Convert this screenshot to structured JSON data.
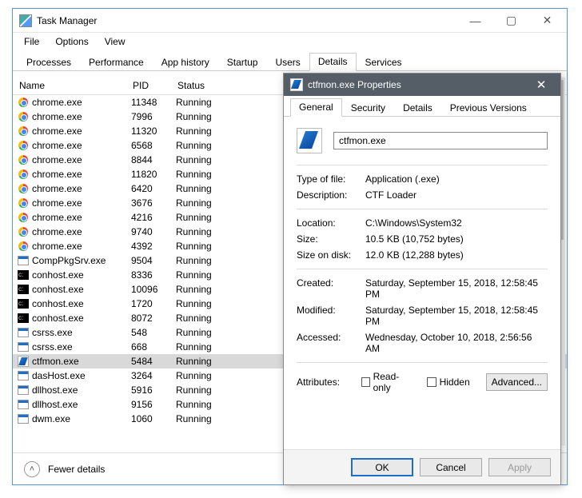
{
  "taskmgr": {
    "title": "Task Manager",
    "menu": {
      "file": "File",
      "options": "Options",
      "view": "View"
    },
    "tabs": {
      "processes": "Processes",
      "performance": "Performance",
      "app_history": "App history",
      "startup": "Startup",
      "users": "Users",
      "details": "Details",
      "services": "Services"
    },
    "columns": {
      "name": "Name",
      "pid": "PID",
      "status": "Status"
    },
    "fewer": "Fewer details",
    "rows": [
      {
        "icon": "chrome",
        "name": "chrome.exe",
        "pid": "11348",
        "status": "Running"
      },
      {
        "icon": "chrome",
        "name": "chrome.exe",
        "pid": "7996",
        "status": "Running"
      },
      {
        "icon": "chrome",
        "name": "chrome.exe",
        "pid": "11320",
        "status": "Running"
      },
      {
        "icon": "chrome",
        "name": "chrome.exe",
        "pid": "6568",
        "status": "Running"
      },
      {
        "icon": "chrome",
        "name": "chrome.exe",
        "pid": "8844",
        "status": "Running"
      },
      {
        "icon": "chrome",
        "name": "chrome.exe",
        "pid": "11820",
        "status": "Running"
      },
      {
        "icon": "chrome",
        "name": "chrome.exe",
        "pid": "6420",
        "status": "Running"
      },
      {
        "icon": "chrome",
        "name": "chrome.exe",
        "pid": "3676",
        "status": "Running"
      },
      {
        "icon": "chrome",
        "name": "chrome.exe",
        "pid": "4216",
        "status": "Running"
      },
      {
        "icon": "chrome",
        "name": "chrome.exe",
        "pid": "9740",
        "status": "Running"
      },
      {
        "icon": "chrome",
        "name": "chrome.exe",
        "pid": "4392",
        "status": "Running"
      },
      {
        "icon": "exe",
        "name": "CompPkgSrv.exe",
        "pid": "9504",
        "status": "Running"
      },
      {
        "icon": "cmd",
        "name": "conhost.exe",
        "pid": "8336",
        "status": "Running"
      },
      {
        "icon": "cmd",
        "name": "conhost.exe",
        "pid": "10096",
        "status": "Running"
      },
      {
        "icon": "cmd",
        "name": "conhost.exe",
        "pid": "1720",
        "status": "Running"
      },
      {
        "icon": "cmd",
        "name": "conhost.exe",
        "pid": "8072",
        "status": "Running"
      },
      {
        "icon": "exe",
        "name": "csrss.exe",
        "pid": "548",
        "status": "Running"
      },
      {
        "icon": "exe",
        "name": "csrss.exe",
        "pid": "668",
        "status": "Running"
      },
      {
        "icon": "ctf",
        "name": "ctfmon.exe",
        "pid": "5484",
        "status": "Running",
        "selected": true
      },
      {
        "icon": "exe",
        "name": "dasHost.exe",
        "pid": "3264",
        "status": "Running"
      },
      {
        "icon": "exe",
        "name": "dllhost.exe",
        "pid": "5916",
        "status": "Running"
      },
      {
        "icon": "exe",
        "name": "dllhost.exe",
        "pid": "9156",
        "status": "Running"
      },
      {
        "icon": "exe",
        "name": "dwm.exe",
        "pid": "1060",
        "status": "Running"
      }
    ]
  },
  "props": {
    "title": "ctfmon.exe Properties",
    "tabs": {
      "general": "General",
      "security": "Security",
      "details": "Details",
      "prev": "Previous Versions"
    },
    "filename": "ctfmon.exe",
    "fields": {
      "typeoffile_label": "Type of file:",
      "typeoffile_value": "Application (.exe)",
      "description_label": "Description:",
      "description_value": "CTF Loader",
      "location_label": "Location:",
      "location_value": "C:\\Windows\\System32",
      "size_label": "Size:",
      "size_value": "10.5 KB (10,752 bytes)",
      "sizeondisk_label": "Size on disk:",
      "sizeondisk_value": "12.0 KB (12,288 bytes)",
      "created_label": "Created:",
      "created_value": "Saturday, September 15, 2018, 12:58:45 PM",
      "modified_label": "Modified:",
      "modified_value": "Saturday, September 15, 2018, 12:58:45 PM",
      "accessed_label": "Accessed:",
      "accessed_value": "Wednesday, October 10, 2018, 2:56:56 AM",
      "attributes_label": "Attributes:",
      "readonly_label": "Read-only",
      "hidden_label": "Hidden",
      "advanced_label": "Advanced..."
    },
    "buttons": {
      "ok": "OK",
      "cancel": "Cancel",
      "apply": "Apply"
    }
  }
}
